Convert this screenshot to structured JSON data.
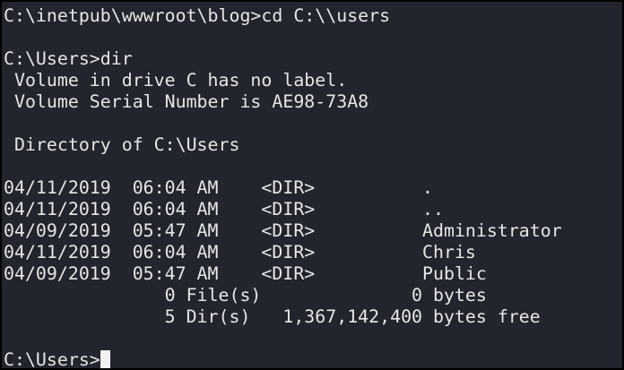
{
  "terminal": {
    "lines": [
      "C:\\inetpub\\wwwroot\\blog>cd C:\\\\users",
      "",
      "C:\\Users>dir",
      " Volume in drive C has no label.",
      " Volume Serial Number is AE98-73A8",
      "",
      " Directory of C:\\Users",
      "",
      "04/11/2019  06:04 AM    <DIR>          .",
      "04/11/2019  06:04 AM    <DIR>          ..",
      "04/09/2019  05:47 AM    <DIR>          Administrator",
      "04/11/2019  06:04 AM    <DIR>          Chris",
      "04/09/2019  05:47 AM    <DIR>          Public",
      "               0 File(s)              0 bytes",
      "               5 Dir(s)   1,367,142,400 bytes free",
      ""
    ],
    "prompt": "C:\\Users>"
  }
}
